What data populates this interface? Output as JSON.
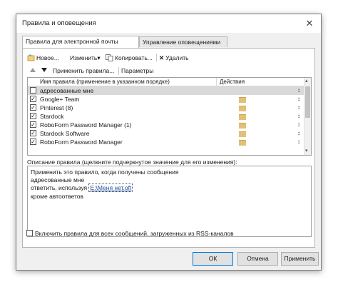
{
  "dialog": {
    "title": "Правила и оповещения",
    "close_glyph": "✕",
    "tabs": [
      {
        "label": "Правила для электронной почты",
        "active": true
      },
      {
        "label": "Управление оповещениями",
        "active": false
      }
    ],
    "toolbar": {
      "new_label": "Новое...",
      "change_label": "Изменить",
      "change_caret": "▾",
      "copy_label": "Копировать...",
      "delete_label": "Удалить",
      "delete_glyph": "✕",
      "apply_label": "Применить правила...",
      "params_label": "Параметры"
    },
    "rules_table": {
      "col_name": "Имя правила (применение в указанном порядке)",
      "col_actions": "Действия",
      "rows": [
        {
          "name": "адресованные мне",
          "checked": false,
          "selected": true
        },
        {
          "name": "Google+ Team",
          "checked": true,
          "selected": false
        },
        {
          "name": "Pinterest (8)",
          "checked": true,
          "selected": false
        },
        {
          "name": "Stardock",
          "checked": true,
          "selected": false
        },
        {
          "name": "RoboForm Password Manager (1)",
          "checked": true,
          "selected": false
        },
        {
          "name": "Stardock Software",
          "checked": true,
          "selected": false
        },
        {
          "name": "RoboForm Password Manager",
          "checked": true,
          "selected": false
        }
      ]
    },
    "description": {
      "label": "Описание правила (щелкните подчеркнутое значение для его изменения):",
      "line1": "Применить это правило, когда получены сообщения",
      "line2": "адресованные мне",
      "line3_prefix": "ответить, используя",
      "line3_link": "E:\\Меня нет.oft",
      "line4": "кроме автоответов"
    },
    "rss_label": "Включить правила для всех сообщений, загруженных из RSS-каналов",
    "buttons": {
      "ok": "ОК",
      "cancel": "Отмена",
      "apply": "Применить"
    }
  }
}
